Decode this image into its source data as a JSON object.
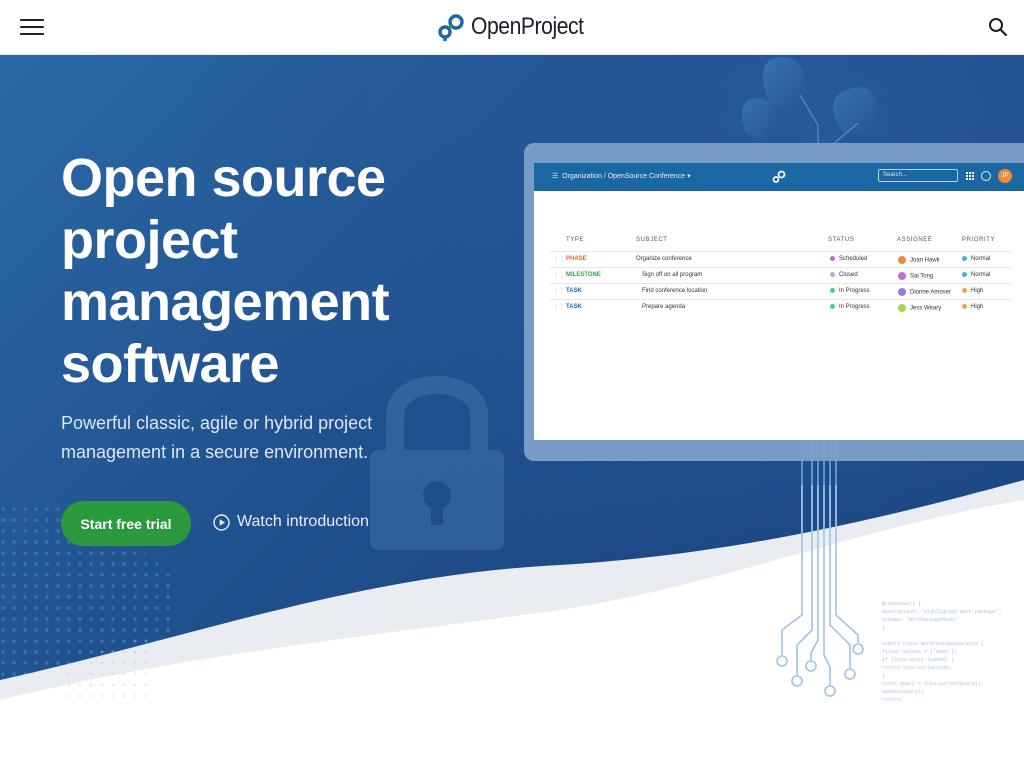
{
  "header": {
    "brand_name": "OpenProject",
    "menu_icon": "hamburger-menu-icon",
    "search_icon": "search-icon"
  },
  "hero": {
    "headline_lines": [
      "Open source",
      "project",
      "management",
      "software"
    ],
    "subtitle_lines": [
      "Powerful classic, agile or hybrid project",
      "management in a secure environment."
    ],
    "primary_button": "Start free trial",
    "video_link": "Watch introduction"
  },
  "app_preview": {
    "breadcrumb": "Organization / OpenSource Conference",
    "search_placeholder": "Search...",
    "avatar_initials": "JP",
    "columns": [
      "TYPE",
      "SUBJECT",
      "STATUS",
      "ASSIGNEE",
      "PRIORITY"
    ],
    "rows": [
      {
        "type": "PHASE",
        "type_color": "#e0642c",
        "subject": "Organize conference",
        "status": "Scheduled",
        "status_color": "#c46ad8",
        "assignee": "Joan Hawk",
        "assignee_color": "#f08b3a",
        "priority": "Normal",
        "priority_color": "#46b0c9"
      },
      {
        "type": "MILESTONE",
        "type_color": "#35a34b",
        "subject": "Sign off on all program",
        "status": "Closed",
        "status_color": "#b9a7e0",
        "assignee": "Sai Tong",
        "assignee_color": "#c46ad8",
        "priority": "Normal",
        "priority_color": "#46b0c9"
      },
      {
        "type": "TASK",
        "type_color": "#1a67a3",
        "subject": "Find conference location",
        "status": "In Progress",
        "status_color": "#46c9b0",
        "assignee": "Dionne Amoser",
        "assignee_color": "#9b7ad8",
        "priority": "High",
        "priority_color": "#f0a04a"
      },
      {
        "type": "TASK",
        "type_color": "#1a67a3",
        "subject": "Prepare agenda",
        "status": "In Progress",
        "status_color": "#46c9b0",
        "assignee": "Jess Weary",
        "assignee_color": "#a6d84a",
        "priority": "High",
        "priority_color": "#f0a04a"
      }
    ]
  },
  "code_lines": [
    "@response() {",
    "  description: 'Highlighted work-package',",
    "  schema: 'WorkPackageModel'",
    "}",
    "",
    "export class WorkPackagesService {",
    "  filter.values = ['open'];",
    "  if (this.state.loaded) {",
    "    return this.collection;",
    "  }",
    "  const query = this.currentQuery();",
    "    update(query);",
    "    return;"
  ],
  "colors": {
    "brand_blue": "#1a67a3",
    "hero_dark": "#173f79",
    "cta_green": "#2a9a3c"
  }
}
